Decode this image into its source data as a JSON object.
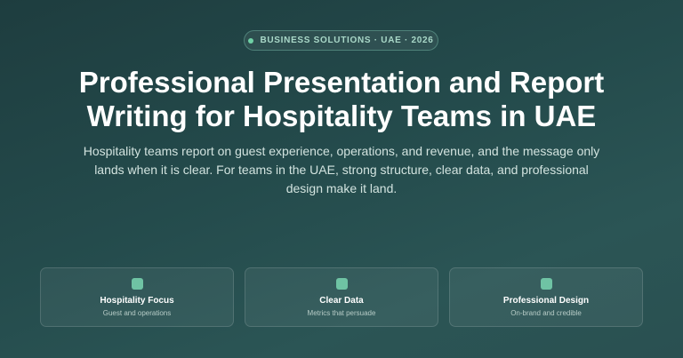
{
  "badge": {
    "text": "BUSINESS SOLUTIONS · UAE · 2026"
  },
  "hero": {
    "title": "Professional Presentation and Report Writing for Hospitality Teams in UAE",
    "subtitle": "Hospitality teams report on guest experience, operations, and revenue, and the message only lands when it is clear. For teams in the UAE, strong structure, clear data, and professional design make it land."
  },
  "features": [
    {
      "icon": "square-icon",
      "title": "Hospitality Focus",
      "subtitle": "Guest and operations"
    },
    {
      "icon": "square-icon",
      "title": "Clear Data",
      "subtitle": "Metrics that persuade"
    },
    {
      "icon": "square-icon",
      "title": "Professional Design",
      "subtitle": "On-brand and credible"
    }
  ],
  "colors": {
    "accent": "#6fc3a4",
    "badge_dot": "#6fd1a6",
    "background": "#244b4c"
  }
}
